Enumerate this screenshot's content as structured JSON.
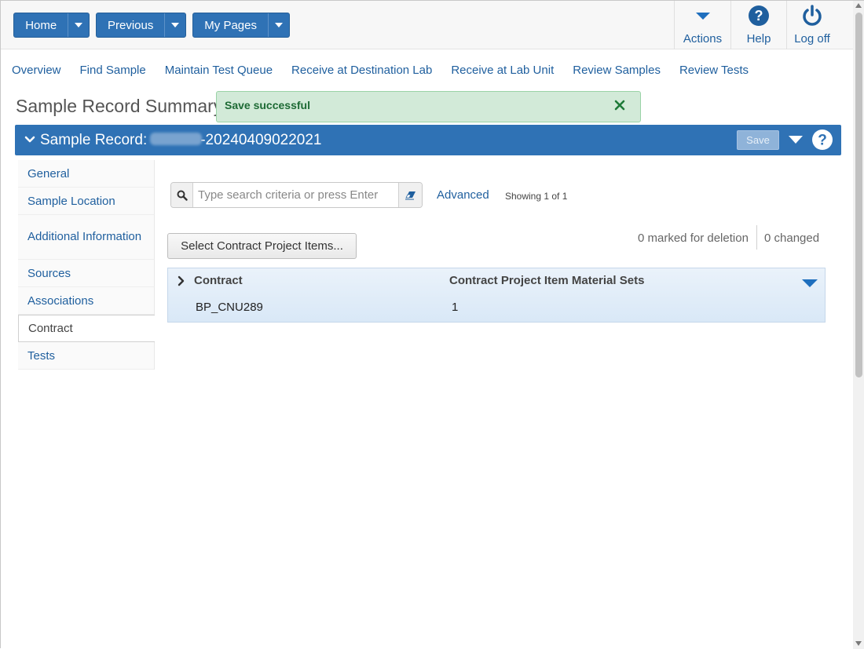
{
  "top_nav": {
    "home_label": "Home",
    "previous_label": "Previous",
    "my_pages_label": "My Pages",
    "actions_label": "Actions",
    "help_label": "Help",
    "logoff_label": "Log off"
  },
  "links": [
    "Overview",
    "Find Sample",
    "Maintain Test Queue",
    "Receive at Destination Lab",
    "Receive at Lab Unit",
    "Review Samples",
    "Review Tests"
  ],
  "page_title": "Sample Record Summary",
  "toast": {
    "message": "Save successful"
  },
  "record_header": {
    "prefix": "Sample Record:",
    "record_id_suffix": "-20240409022021",
    "save_label": "Save"
  },
  "sidebar": {
    "items": [
      {
        "label": "General"
      },
      {
        "label": "Sample Location"
      },
      {
        "label": "Additional Information"
      },
      {
        "label": "Sources"
      },
      {
        "label": "Associations"
      },
      {
        "label": "Contract"
      },
      {
        "label": "Tests"
      }
    ],
    "active": "Contract"
  },
  "search": {
    "placeholder": "Type search criteria or press Enter",
    "value": "",
    "advanced_label": "Advanced",
    "showing": "Showing 1 of 1"
  },
  "toolbar": {
    "select_button_label": "Select Contract Project Items...",
    "marked_for_deletion": "0 marked for deletion",
    "changed": "0 changed"
  },
  "grid": {
    "headers": [
      "Contract",
      "Contract Project Item Material Sets"
    ],
    "rows": [
      {
        "contract": "BP_CNU289",
        "material_sets": "1"
      }
    ]
  },
  "colors": {
    "primary": "#2f72b5",
    "link": "#1f5f9e",
    "toast_bg": "#d2ead8",
    "toast_text": "#1d6a34"
  },
  "icons": [
    "chevron-down-icon",
    "caret-down-icon",
    "help-circle-icon",
    "power-icon",
    "check-icon",
    "close-icon",
    "search-icon",
    "eraser-icon",
    "chevron-right-icon"
  ]
}
